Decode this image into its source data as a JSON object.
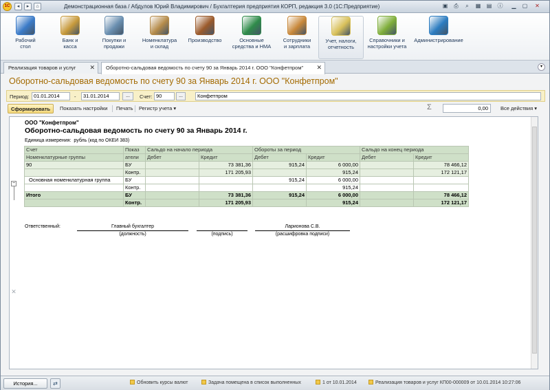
{
  "app": {
    "title": "Демонстрационная база / Абдулов Юрий Владимирович / Бухгалтерия предприятия КОРП, редакция 3.0  (1С:Предприятие)"
  },
  "sections": [
    {
      "label": "Рабочий\nстол",
      "icon": "desktop-icon",
      "color": "#3b7bc8"
    },
    {
      "label": "Банк и\nкасса",
      "icon": "bank-icon",
      "color": "#c79a3c"
    },
    {
      "label": "Покупки и\nпродажи",
      "icon": "cart-icon",
      "color": "#6a8fb0"
    },
    {
      "label": "Номенклатура\nи склад",
      "icon": "warehouse-icon",
      "color": "#b58b4a"
    },
    {
      "label": "Производство",
      "icon": "production-icon",
      "color": "#9b5a2b"
    },
    {
      "label": "Основные\nсредства и НМА",
      "icon": "assets-icon",
      "color": "#2f8b4a"
    },
    {
      "label": "Сотрудники\nи зарплата",
      "icon": "employees-icon",
      "color": "#c8883a"
    },
    {
      "label": "Учет, налоги,\nотчетность",
      "icon": "accounting-icon",
      "color": "#d8c05a"
    },
    {
      "label": "Справочники и\nнастройки учета",
      "icon": "books-icon",
      "color": "#7fae3a"
    },
    {
      "label": "Администрирование",
      "icon": "admin-icon",
      "color": "#2c7cc0"
    }
  ],
  "tabs": [
    {
      "label": "Реализация товаров и услуг"
    },
    {
      "label": "Оборотно-сальдовая ведомость по счету 90 за Январь 2014 г. ООО \"Конфетпром\""
    }
  ],
  "form": {
    "title": "Оборотно-сальдовая ведомость по счету 90 за Январь 2014 г. ООО \"Конфетпром\"",
    "period_label": "Период:",
    "period_from": "01.01.2014",
    "period_dash": "-",
    "period_to": "31.01.2014",
    "dots": "...",
    "account_label": "Счет:",
    "account": "90",
    "organization": "Конфетпром"
  },
  "toolbar": {
    "generate": "Сформировать",
    "show_settings": "Показать настройки",
    "print": "Печать",
    "register": "Регистр учета ▾",
    "sigma": "Σ",
    "sum": "0,00",
    "all_actions": "Все действия ▾"
  },
  "report": {
    "org": "ООО \"Конфетпром\"",
    "title": "Оборотно-сальдовая ведомость по счету 90 за Январь 2014 г.",
    "units_label": "Единица измерения:",
    "units_value": "рубль (код по ОКЕИ 383)",
    "headers": {
      "account": "Счет",
      "indicator1": "Показ",
      "indicator2": "атели",
      "nomenclature": "Номенклатурные группы",
      "opening": "Сальдо на начало периода",
      "turnover": "Обороты за период",
      "closing": "Сальдо на конец периода",
      "debit": "Дебет",
      "credit": "Кредит"
    },
    "rows": [
      {
        "name": "90",
        "ind": "БУ",
        "od": "",
        "oc": "73 381,36",
        "td": "915,24",
        "tc": "6 000,00",
        "cd": "",
        "cc": "78 466,12"
      },
      {
        "name": "",
        "ind": "Контр.",
        "od": "",
        "oc": "171 205,93",
        "td": "",
        "tc": "915,24",
        "cd": "",
        "cc": "172 121,17"
      },
      {
        "name": "Основная номенклатурная группа",
        "ind": "БУ",
        "od": "",
        "oc": "",
        "td": "915,24",
        "tc": "6 000,00",
        "cd": "",
        "cc": ""
      },
      {
        "name": "",
        "ind": "Контр.",
        "od": "",
        "oc": "",
        "td": "",
        "tc": "915,24",
        "cd": "",
        "cc": ""
      },
      {
        "name": "Итого",
        "ind": "БУ",
        "od": "",
        "oc": "73 381,36",
        "td": "915,24",
        "tc": "6 000,00",
        "cd": "",
        "cc": "78 466,12"
      },
      {
        "name": "",
        "ind": "Контр.",
        "od": "",
        "oc": "171 205,93",
        "td": "",
        "tc": "915,24",
        "cd": "",
        "cc": "172 121,17"
      }
    ],
    "signature": {
      "responsible": "Ответственный:",
      "position_value": "Главный бухгалтер",
      "position_caption": "(должность)",
      "sign_caption": "(подпись)",
      "name_value": "Ларионова С.В.",
      "name_caption": "(расшифровка подписи)"
    }
  },
  "status": {
    "history": "История...",
    "items": [
      "Обновить курсы валют",
      "Задача помещена в список выполненных",
      "1 от 10.01.2014",
      "Реализация товаров и услуг КП00-000009 от 10.01.2014 10:27:06"
    ]
  }
}
